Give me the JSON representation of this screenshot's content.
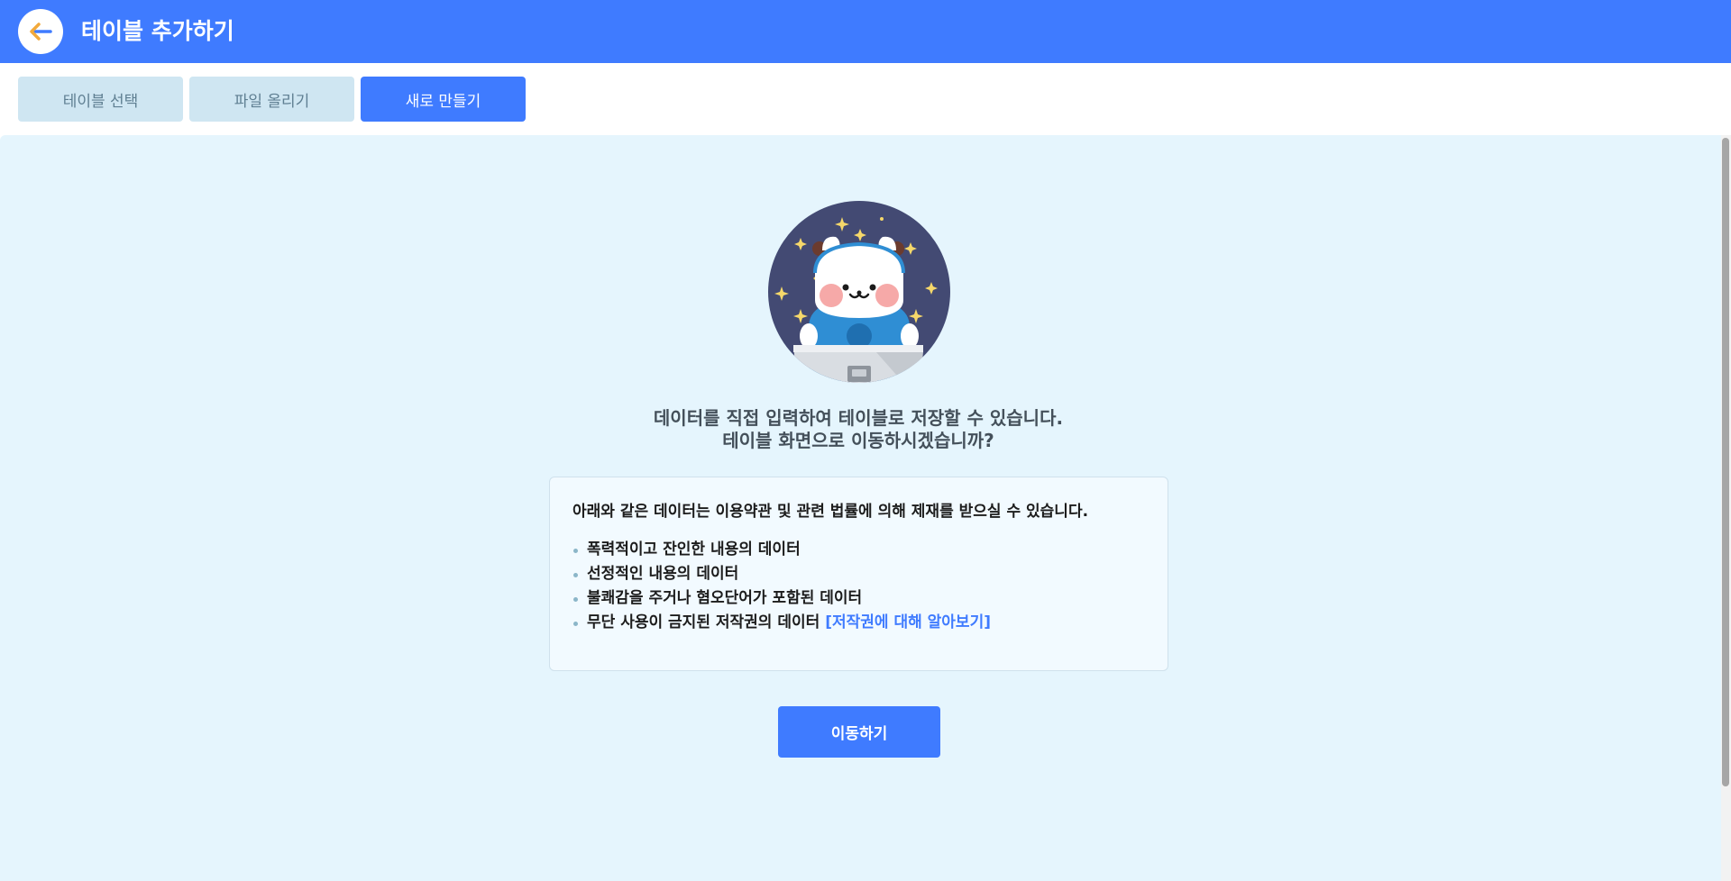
{
  "header": {
    "title": "테이블 추가하기",
    "back_icon": "arrow-left-icon"
  },
  "tabs": [
    {
      "label": "테이블 선택",
      "active": false
    },
    {
      "label": "파일 올리기",
      "active": false
    },
    {
      "label": "새로 만들기",
      "active": true
    }
  ],
  "main": {
    "message_line1": "데이터를 직접 입력하여 테이블로 저장할 수 있습니다.",
    "message_line2": "테이블 화면으로 이동하시겠습니까?",
    "notice": {
      "title": "아래와 같은 데이터는 이용약관 및 관련 법률에 의해 제재를 받으실 수 있습니다.",
      "items": [
        "폭력적이고 잔인한 내용의 데이터",
        "선정적인 내용의 데이터",
        "불쾌감을 주거나 혐오단어가 포함된 데이터",
        "무단 사용이 금지된 저작권의 데이터"
      ],
      "link_label": "[저작권에 대해 알아보기]"
    },
    "move_button_label": "이동하기"
  },
  "colors": {
    "brand": "#3f7bff",
    "panel_background": "#e5f5fd",
    "tab_inactive": "#cfe6f2"
  }
}
